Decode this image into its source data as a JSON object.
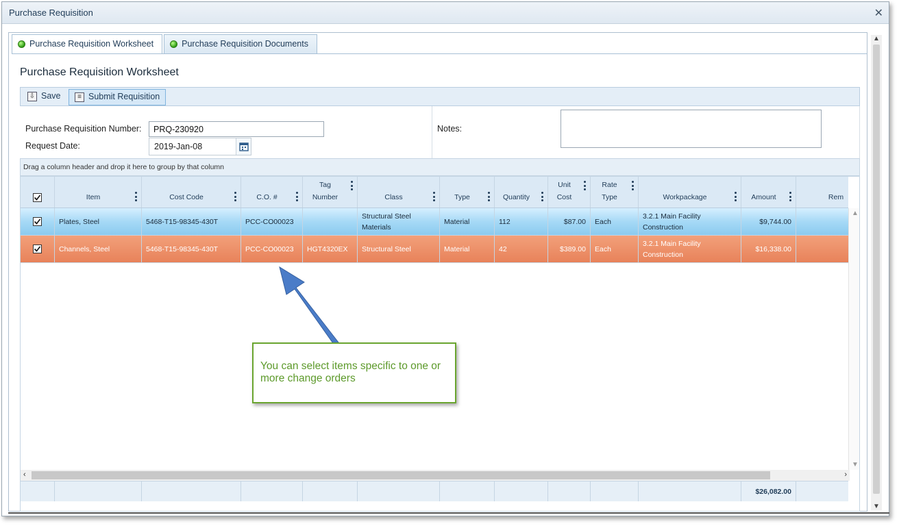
{
  "window": {
    "title": "Purchase Requisition"
  },
  "tabs": [
    {
      "label": "Purchase Requisition Worksheet",
      "active": true
    },
    {
      "label": "Purchase Requisition Documents",
      "active": false
    }
  ],
  "page": {
    "heading": "Purchase Requisition Worksheet"
  },
  "toolbar": {
    "save_label": "Save",
    "submit_label": "Submit Requisition"
  },
  "form": {
    "number_label": "Purchase Requisition Number:",
    "number_value": "PRQ-230920",
    "date_label": "Request Date:",
    "date_value": "2019-Jan-08",
    "notes_label": "Notes:",
    "notes_value": ""
  },
  "grid": {
    "group_hint": "Drag a column header and drop it here to group by that column",
    "headers": {
      "item": "Item",
      "cost_code": "Cost Code",
      "co": "C.O. #",
      "tag": "Tag\nNumber",
      "class": "Class",
      "type": "Type",
      "quantity": "Quantity",
      "unit_cost": "Unit\nCost",
      "rate_type": "Rate\nType",
      "workpackage": "Workpackage",
      "amount": "Amount",
      "remarks": "Rem"
    },
    "rows": [
      {
        "checked": true,
        "item": "Plates, Steel",
        "cost_code": "5468-T15-98345-430T",
        "co": "PCC-CO00023",
        "tag": "",
        "class": "Structural Steel Materials",
        "type": "Material",
        "quantity": "112",
        "unit_cost": "$87.00",
        "rate_type": "Each",
        "workpackage": "3.2.1 Main Facility Construction",
        "amount": "$9,744.00",
        "remarks": ""
      },
      {
        "checked": true,
        "item": "Channels, Steel",
        "cost_code": "5468-T15-98345-430T",
        "co": "PCC-CO00023",
        "tag": "HGT4320EX",
        "class": "Structural Steel",
        "type": "Material",
        "quantity": "42",
        "unit_cost": "$389.00",
        "rate_type": "Each",
        "workpackage": "3.2.1 Main Facility Construction",
        "amount": "$16,338.00",
        "remarks": ""
      }
    ],
    "total_amount": "$26,082.00"
  },
  "callout": {
    "text": "You can select items specific to one or more change orders"
  },
  "colors": {
    "row_selected": "#8ccbef",
    "row_highlight": "#e8825a",
    "callout_border": "#6aa52f",
    "arrow": "#4a7cc8"
  }
}
